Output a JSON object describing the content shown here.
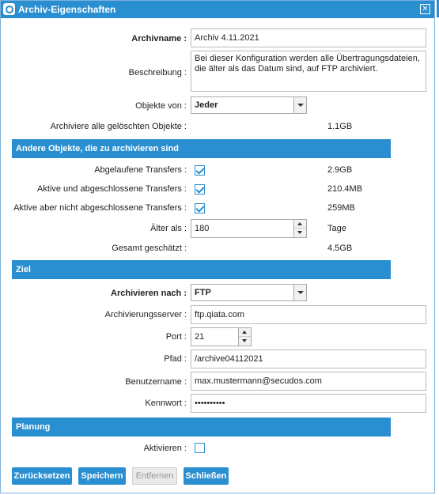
{
  "dialog": {
    "title": "Archiv-Eigenschaften",
    "close_symbol": "✕"
  },
  "fields": {
    "archivname_label": "Archivname :",
    "archivname_value": "Archiv 4.11.2021",
    "beschreibung_label": "Beschreibung :",
    "beschreibung_value": "Bei dieser Konfiguration werden alle Übertragungsdateien, die älter als das Datum sind, auf FTP archiviert.",
    "objekte_von_label": "Objekte von :",
    "objekte_von_value": "Jeder",
    "archiviere_label": "Archiviere alle gelöschten Objekte :",
    "archiviere_value": "1.1GB"
  },
  "section_andere": {
    "title": "Andere Objekte, die zu archivieren sind",
    "abgelaufene_label": "Abgelaufene Transfers :",
    "abgelaufene_size": "2.9GB",
    "aktive_abgeschlossene_label": "Aktive und abgeschlossene Transfers :",
    "aktive_abgeschlossene_size": "210.4MB",
    "aktive_nicht_label": "Aktive aber nicht abgeschlossene Transfers :",
    "aktive_nicht_size": "259MB",
    "aelter_label": "Älter als :",
    "aelter_value": "180",
    "aelter_unit": "Tage",
    "gesamt_label": "Gesamt geschätzt :",
    "gesamt_value": "4.5GB"
  },
  "section_ziel": {
    "title": "Ziel",
    "archivieren_nach_label": "Archivieren nach :",
    "archivieren_nach_value": "FTP",
    "server_label": "Archivierungsserver :",
    "server_value": "ftp.qiata.com",
    "port_label": "Port :",
    "port_value": "21",
    "pfad_label": "Pfad :",
    "pfad_value": "/archive04112021",
    "benutzer_label": "Benutzername :",
    "benutzer_value": "max.mustermann@secudos.com",
    "kennwort_label": "Kennwort :",
    "kennwort_value": "••••••••••"
  },
  "section_planung": {
    "title": "Planung",
    "aktivieren_label": "Aktivieren :"
  },
  "buttons": {
    "reset": "Zurücksetzen",
    "save": "Speichern",
    "remove": "Entfernen",
    "close": "Schließen"
  },
  "colors": {
    "accent": "#2a8fd1"
  }
}
